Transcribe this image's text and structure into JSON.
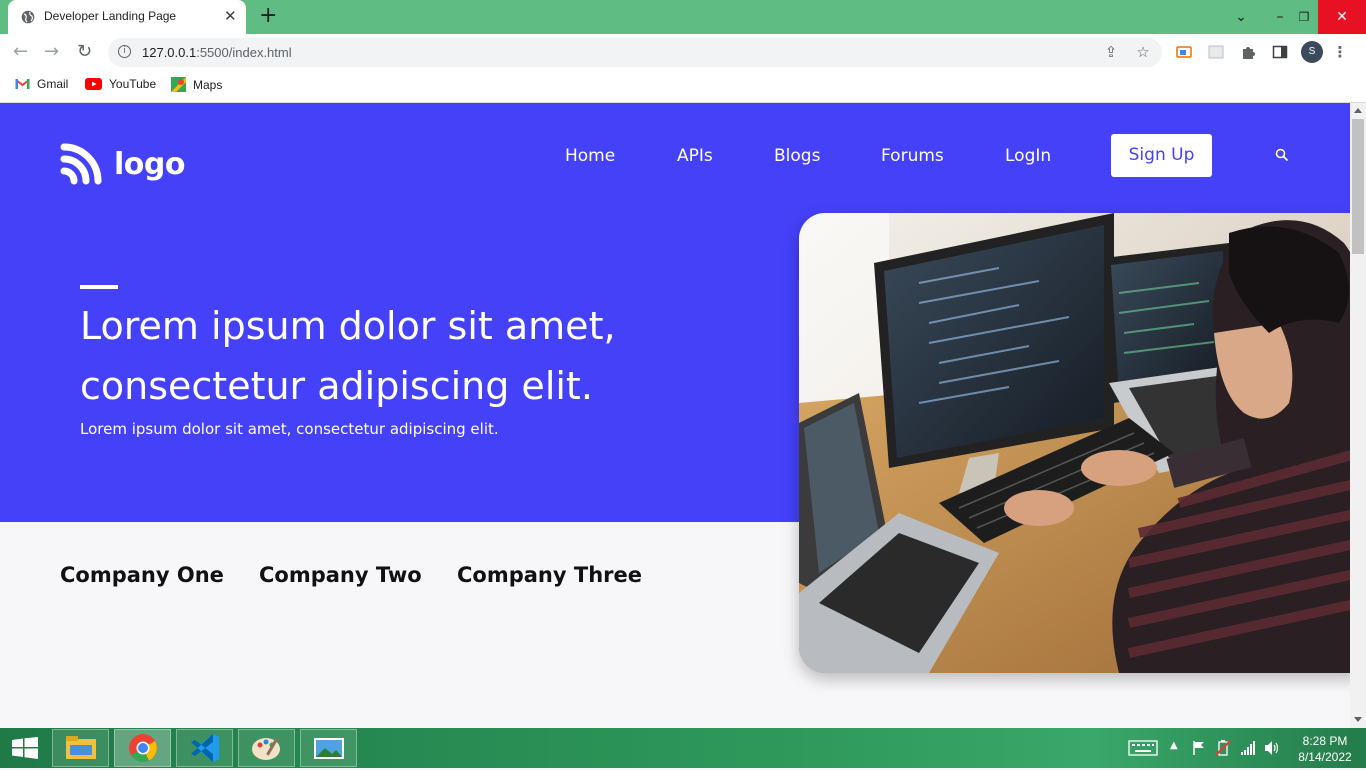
{
  "browser": {
    "tab_title": "Developer Landing Page",
    "tab_close": "✕",
    "new_tab": "+",
    "url_host": "127.0.0.1",
    "url_rest": ":5500/index.html",
    "profile_initial": "S",
    "window_controls": {
      "list": "⌄",
      "minimize": "–",
      "restore": "❐",
      "close": "✕"
    },
    "bookmarks": [
      {
        "label": "Gmail",
        "icon": "gmail-icon"
      },
      {
        "label": "YouTube",
        "icon": "youtube-icon"
      },
      {
        "label": "Maps",
        "icon": "maps-icon"
      }
    ]
  },
  "page": {
    "logo_text": "logo",
    "nav": [
      "Home",
      "APIs",
      "Blogs",
      "Forums",
      "LogIn"
    ],
    "signup_label": "Sign Up",
    "headline": "Lorem ipsum dolor sit amet, consectetur adipiscing elit.",
    "subheadline": "Lorem ipsum dolor sit amet, consectetur adipiscing elit.",
    "companies": [
      "Company One",
      "Company Two",
      "Company Three"
    ],
    "hero_image": "developer-at-computers-photo",
    "colors": {
      "brand": "#4541f8",
      "page_bg": "#f7f7f9"
    }
  },
  "taskbar": {
    "apps": [
      "file-explorer-icon",
      "chrome-icon",
      "vscode-icon",
      "paint-icon",
      "photos-icon"
    ],
    "time": "8:28 PM",
    "date": "8/14/2022"
  }
}
